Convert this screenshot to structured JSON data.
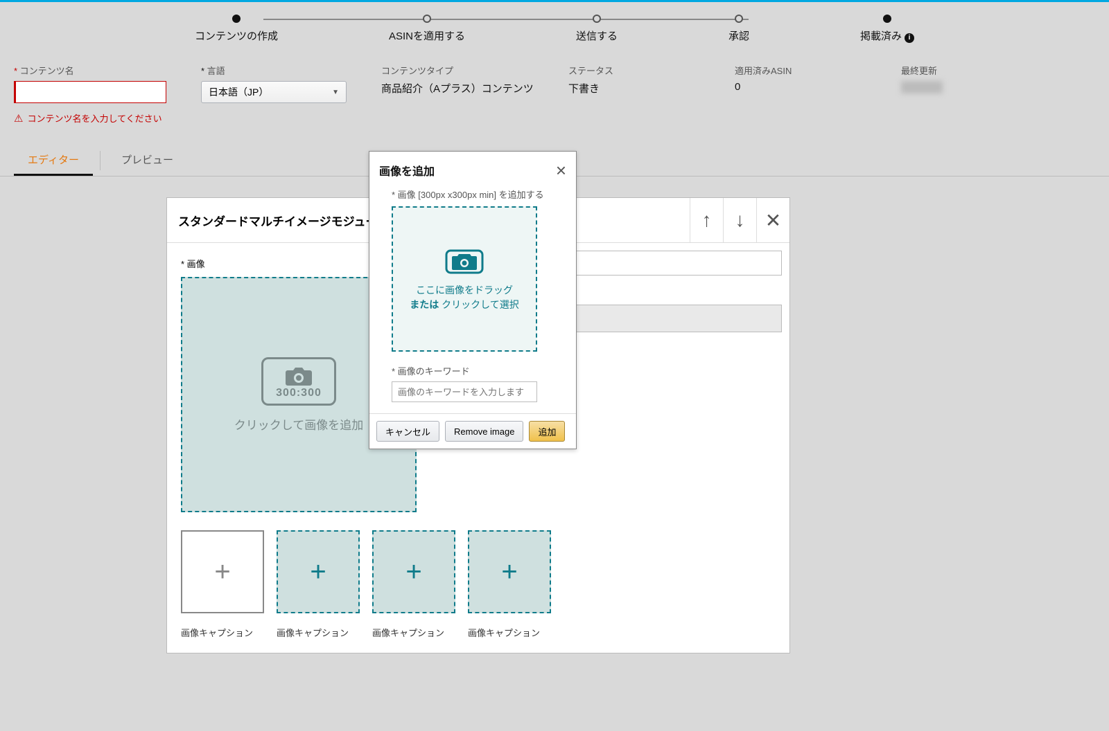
{
  "steps": [
    "コンテンツの作成",
    "ASINを適用する",
    "送信する",
    "承認",
    "掲載済み"
  ],
  "meta": {
    "name_label": "コンテンツ名",
    "name_error": "コンテンツ名を入力してください",
    "lang_label": "言語",
    "lang_value": "日本語（JP）",
    "type_label": "コンテンツタイプ",
    "type_value": "商品紹介（Aプラス）コンテンツ",
    "status_label": "ステータス",
    "status_value": "下書き",
    "asin_label": "適用済みASIN",
    "asin_value": "0",
    "updated_label": "最終更新"
  },
  "tabs": {
    "editor": "エディター",
    "preview": "プレビュー"
  },
  "module": {
    "title": "スタンダードマルチイメージモジュール",
    "image_label": "* 画像",
    "ratio": "300:300",
    "drop_text": "クリックして画像を追加",
    "caption": "画像キャプション"
  },
  "modal": {
    "title": "画像を追加",
    "size_label": "* 画像 [300px x300px min] を追加する",
    "drop_line1": "ここに画像をドラッグ",
    "drop_bold": "または",
    "drop_line2": " クリックして選択",
    "kw_label": "* 画像のキーワード",
    "kw_placeholder": "画像のキーワードを入力します",
    "cancel": "キャンセル",
    "remove": "Remove image",
    "add": "追加"
  }
}
